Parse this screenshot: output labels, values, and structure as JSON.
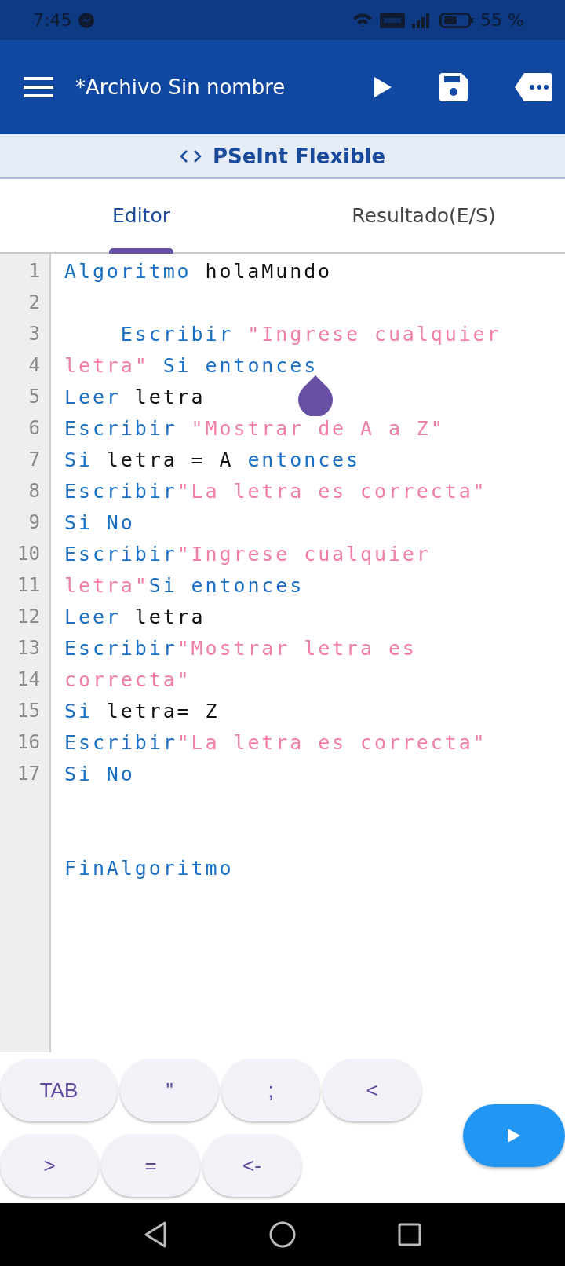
{
  "status_bar": {
    "time": "7:45",
    "battery": "55 %"
  },
  "toolbar": {
    "title": "*Archivo Sin nombre"
  },
  "subheader": {
    "title": "PSeInt Flexible"
  },
  "tabs": [
    {
      "label": "Editor",
      "selected": true
    },
    {
      "label": "Resultado(E/S)",
      "selected": false
    }
  ],
  "editor": {
    "lines": [
      {
        "number": "1",
        "tokens": [
          {
            "text": "Algoritmo",
            "kind": "keyword"
          },
          {
            "text": " holaMundo",
            "kind": "plain"
          }
        ]
      },
      {
        "number": "2"
      },
      {
        "number": "3",
        "tokens": [
          {
            "text": "    Escribir",
            "kind": "keyword"
          },
          {
            "text": " \"Ingrese cualquier",
            "kind": "string"
          }
        ]
      },
      {
        "number": "4",
        "tokens": [
          {
            "text": "letra\"",
            "kind": "string"
          },
          {
            "text": " Si entonces",
            "kind": "keyword"
          }
        ]
      },
      {
        "number": "5",
        "tokens": [
          {
            "text": "Leer",
            "kind": "keyword"
          },
          {
            "text": " letra",
            "kind": "plain"
          }
        ]
      },
      {
        "number": "6",
        "tokens": [
          {
            "text": "Escribir",
            "kind": "keyword"
          },
          {
            "text": " \"Mostrar de A a Z\"",
            "kind": "string"
          }
        ]
      },
      {
        "number": "7",
        "tokens": [
          {
            "text": "Si",
            "kind": "keyword"
          },
          {
            "text": " letra = A ",
            "kind": "plain"
          },
          {
            "text": "entonces",
            "kind": "keyword"
          }
        ]
      },
      {
        "number": "8",
        "tokens": [
          {
            "text": "Escribir",
            "kind": "keyword"
          },
          {
            "text": "\"La letra es correcta\"",
            "kind": "string"
          }
        ]
      },
      {
        "number": "9",
        "tokens": [
          {
            "text": "Si No",
            "kind": "keyword"
          }
        ]
      },
      {
        "number": "10",
        "tokens": [
          {
            "text": "Escribir",
            "kind": "keyword"
          },
          {
            "text": "\"Ingrese cualquier",
            "kind": "string"
          }
        ]
      },
      {
        "number": "11",
        "tokens": [
          {
            "text": "letra\"",
            "kind": "string"
          },
          {
            "text": "Si entonces",
            "kind": "keyword"
          }
        ]
      },
      {
        "number": "12",
        "tokens": [
          {
            "text": "Leer",
            "kind": "keyword"
          },
          {
            "text": " letra",
            "kind": "plain"
          }
        ]
      },
      {
        "number": "13",
        "tokens": [
          {
            "text": "Escribir",
            "kind": "keyword"
          },
          {
            "text": "\"Mostrar letra es",
            "kind": "string"
          }
        ]
      },
      {
        "number": "14",
        "tokens": [
          {
            "text": "correcta\"",
            "kind": "string"
          }
        ]
      },
      {
        "number": "15",
        "tokens": [
          {
            "text": "Si",
            "kind": "keyword"
          },
          {
            "text": " letra= Z",
            "kind": "plain"
          }
        ]
      },
      {
        "number": "16",
        "tokens": [
          {
            "text": "Escribir",
            "kind": "keyword"
          },
          {
            "text": "\"La letra es correcta\"",
            "kind": "string"
          }
        ]
      },
      {
        "number": "17",
        "tokens": [
          {
            "text": "Si No",
            "kind": "keyword"
          }
        ]
      }
    ],
    "closing_line": {
      "tokens": [
        {
          "text": "FinAlgoritmo",
          "kind": "keyword"
        }
      ]
    }
  },
  "key_rows": [
    [
      "TAB",
      "\"",
      ";",
      "<"
    ],
    [
      ">",
      "=",
      "<-"
    ]
  ]
}
